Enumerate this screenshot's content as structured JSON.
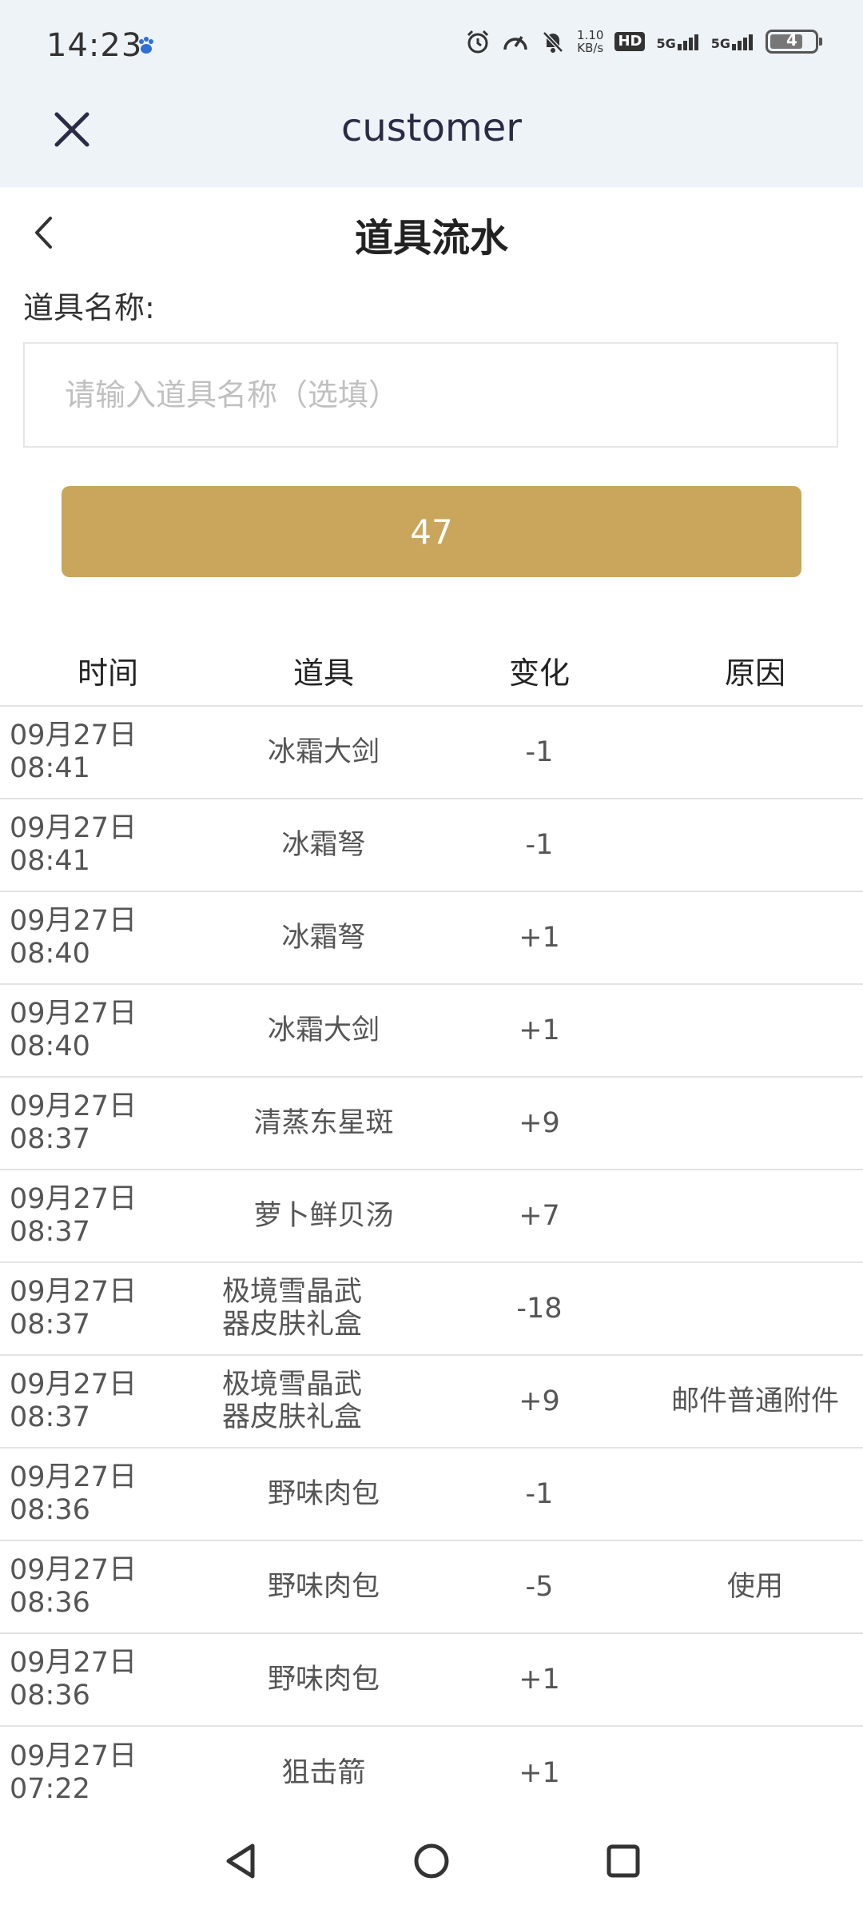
{
  "status_bar": {
    "time": "14:23",
    "net_speed_value": "1.10",
    "net_speed_unit": "KB/s",
    "hd_label": "HD",
    "signal_1": "5G",
    "signal_2": "5G",
    "battery_level": "4"
  },
  "app_header": {
    "title": "customer"
  },
  "page": {
    "title": "道具流水",
    "field_label": "道具名称:",
    "input_placeholder": "请输入道具名称（选填）",
    "input_value": "",
    "submit_label": "47"
  },
  "table": {
    "headers": [
      "时间",
      "道具",
      "变化",
      "原因"
    ],
    "rows": [
      {
        "date": "09月27日",
        "time": "08:41",
        "item": "冰霜大剑",
        "change": "-1",
        "reason": ""
      },
      {
        "date": "09月27日",
        "time": "08:41",
        "item": "冰霜弩",
        "change": "-1",
        "reason": ""
      },
      {
        "date": "09月27日",
        "time": "08:40",
        "item": "冰霜弩",
        "change": "+1",
        "reason": ""
      },
      {
        "date": "09月27日",
        "time": "08:40",
        "item": "冰霜大剑",
        "change": "+1",
        "reason": ""
      },
      {
        "date": "09月27日",
        "time": "08:37",
        "item": "清蒸东星斑",
        "change": "+9",
        "reason": ""
      },
      {
        "date": "09月27日",
        "time": "08:37",
        "item": "萝卜鲜贝汤",
        "change": "+7",
        "reason": ""
      },
      {
        "date": "09月27日",
        "time": "08:37",
        "item": "极境雪晶武器皮肤礼盒",
        "change": "-18",
        "reason": ""
      },
      {
        "date": "09月27日",
        "time": "08:37",
        "item": "极境雪晶武器皮肤礼盒",
        "change": "+9",
        "reason": "邮件普通附件"
      },
      {
        "date": "09月27日",
        "time": "08:36",
        "item": "野味肉包",
        "change": "-1",
        "reason": ""
      },
      {
        "date": "09月27日",
        "time": "08:36",
        "item": "野味肉包",
        "change": "-5",
        "reason": "使用"
      },
      {
        "date": "09月27日",
        "time": "08:36",
        "item": "野味肉包",
        "change": "+1",
        "reason": ""
      },
      {
        "date": "09月27日",
        "time": "07:22",
        "item": "狙击箭",
        "change": "+1",
        "reason": ""
      }
    ]
  },
  "colors": {
    "accent": "#c9a65b",
    "header_bg": "#eef3f7"
  },
  "icons": {
    "close": "close-icon",
    "back": "chevron-left-icon",
    "nav_back": "triangle-back-icon",
    "nav_home": "circle-home-icon",
    "nav_recent": "square-recent-icon"
  }
}
